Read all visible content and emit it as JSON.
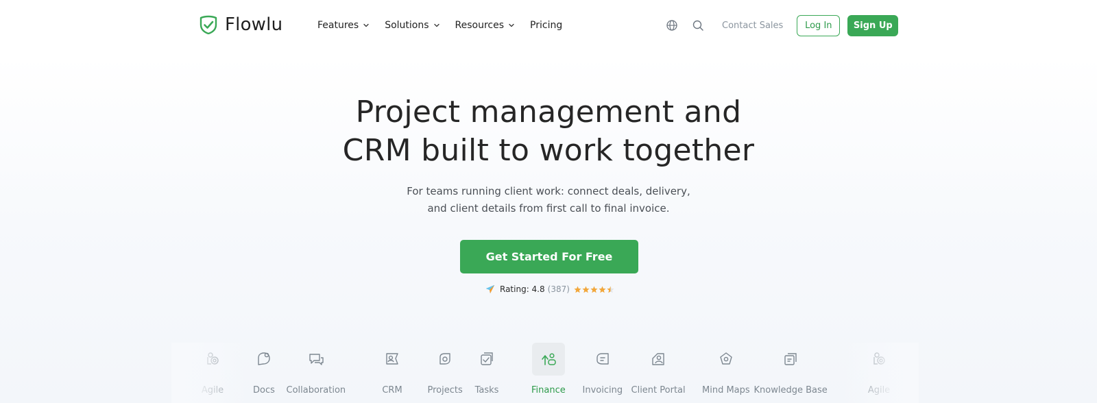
{
  "brand": {
    "name": "Flowlu",
    "accent": "#3aa856"
  },
  "nav": {
    "items": [
      {
        "label": "Features",
        "has_dropdown": true
      },
      {
        "label": "Solutions",
        "has_dropdown": true
      },
      {
        "label": "Resources",
        "has_dropdown": true
      },
      {
        "label": "Pricing",
        "has_dropdown": false
      }
    ]
  },
  "header_actions": {
    "language_icon": "globe-icon",
    "search_icon": "search-icon",
    "contact_label": "Contact Sales",
    "login_label": "Log In",
    "signup_label": "Sign Up"
  },
  "hero": {
    "title_line1": "Project management and",
    "title_line2": "CRM built to work together",
    "subtitle_line1": "For teams running client work: connect deals, delivery,",
    "subtitle_line2": "and client details from first call to final invoice.",
    "cta_label": "Get Started For Free"
  },
  "rating": {
    "label": "Rating: 4.8",
    "count": "(387)",
    "stars": 4.5,
    "star_color": "#f2a73b"
  },
  "features": {
    "active": "Finance",
    "items": [
      {
        "label": "Agile",
        "icon": "agile-icon"
      },
      {
        "label": "Docs",
        "icon": "docs-icon"
      },
      {
        "label": "Collaboration",
        "icon": "collaboration-icon"
      },
      {
        "label": "CRM",
        "icon": "crm-icon"
      },
      {
        "label": "Projects",
        "icon": "projects-icon"
      },
      {
        "label": "Tasks",
        "icon": "tasks-icon"
      },
      {
        "label": "Finance",
        "icon": "finance-icon"
      },
      {
        "label": "Invoicing",
        "icon": "invoicing-icon"
      },
      {
        "label": "Client Portal",
        "icon": "client-portal-icon"
      },
      {
        "label": "Mind Maps",
        "icon": "mind-maps-icon"
      },
      {
        "label": "Knowledge Base",
        "icon": "knowledge-base-icon"
      },
      {
        "label": "Agile",
        "icon": "agile-icon"
      }
    ]
  }
}
